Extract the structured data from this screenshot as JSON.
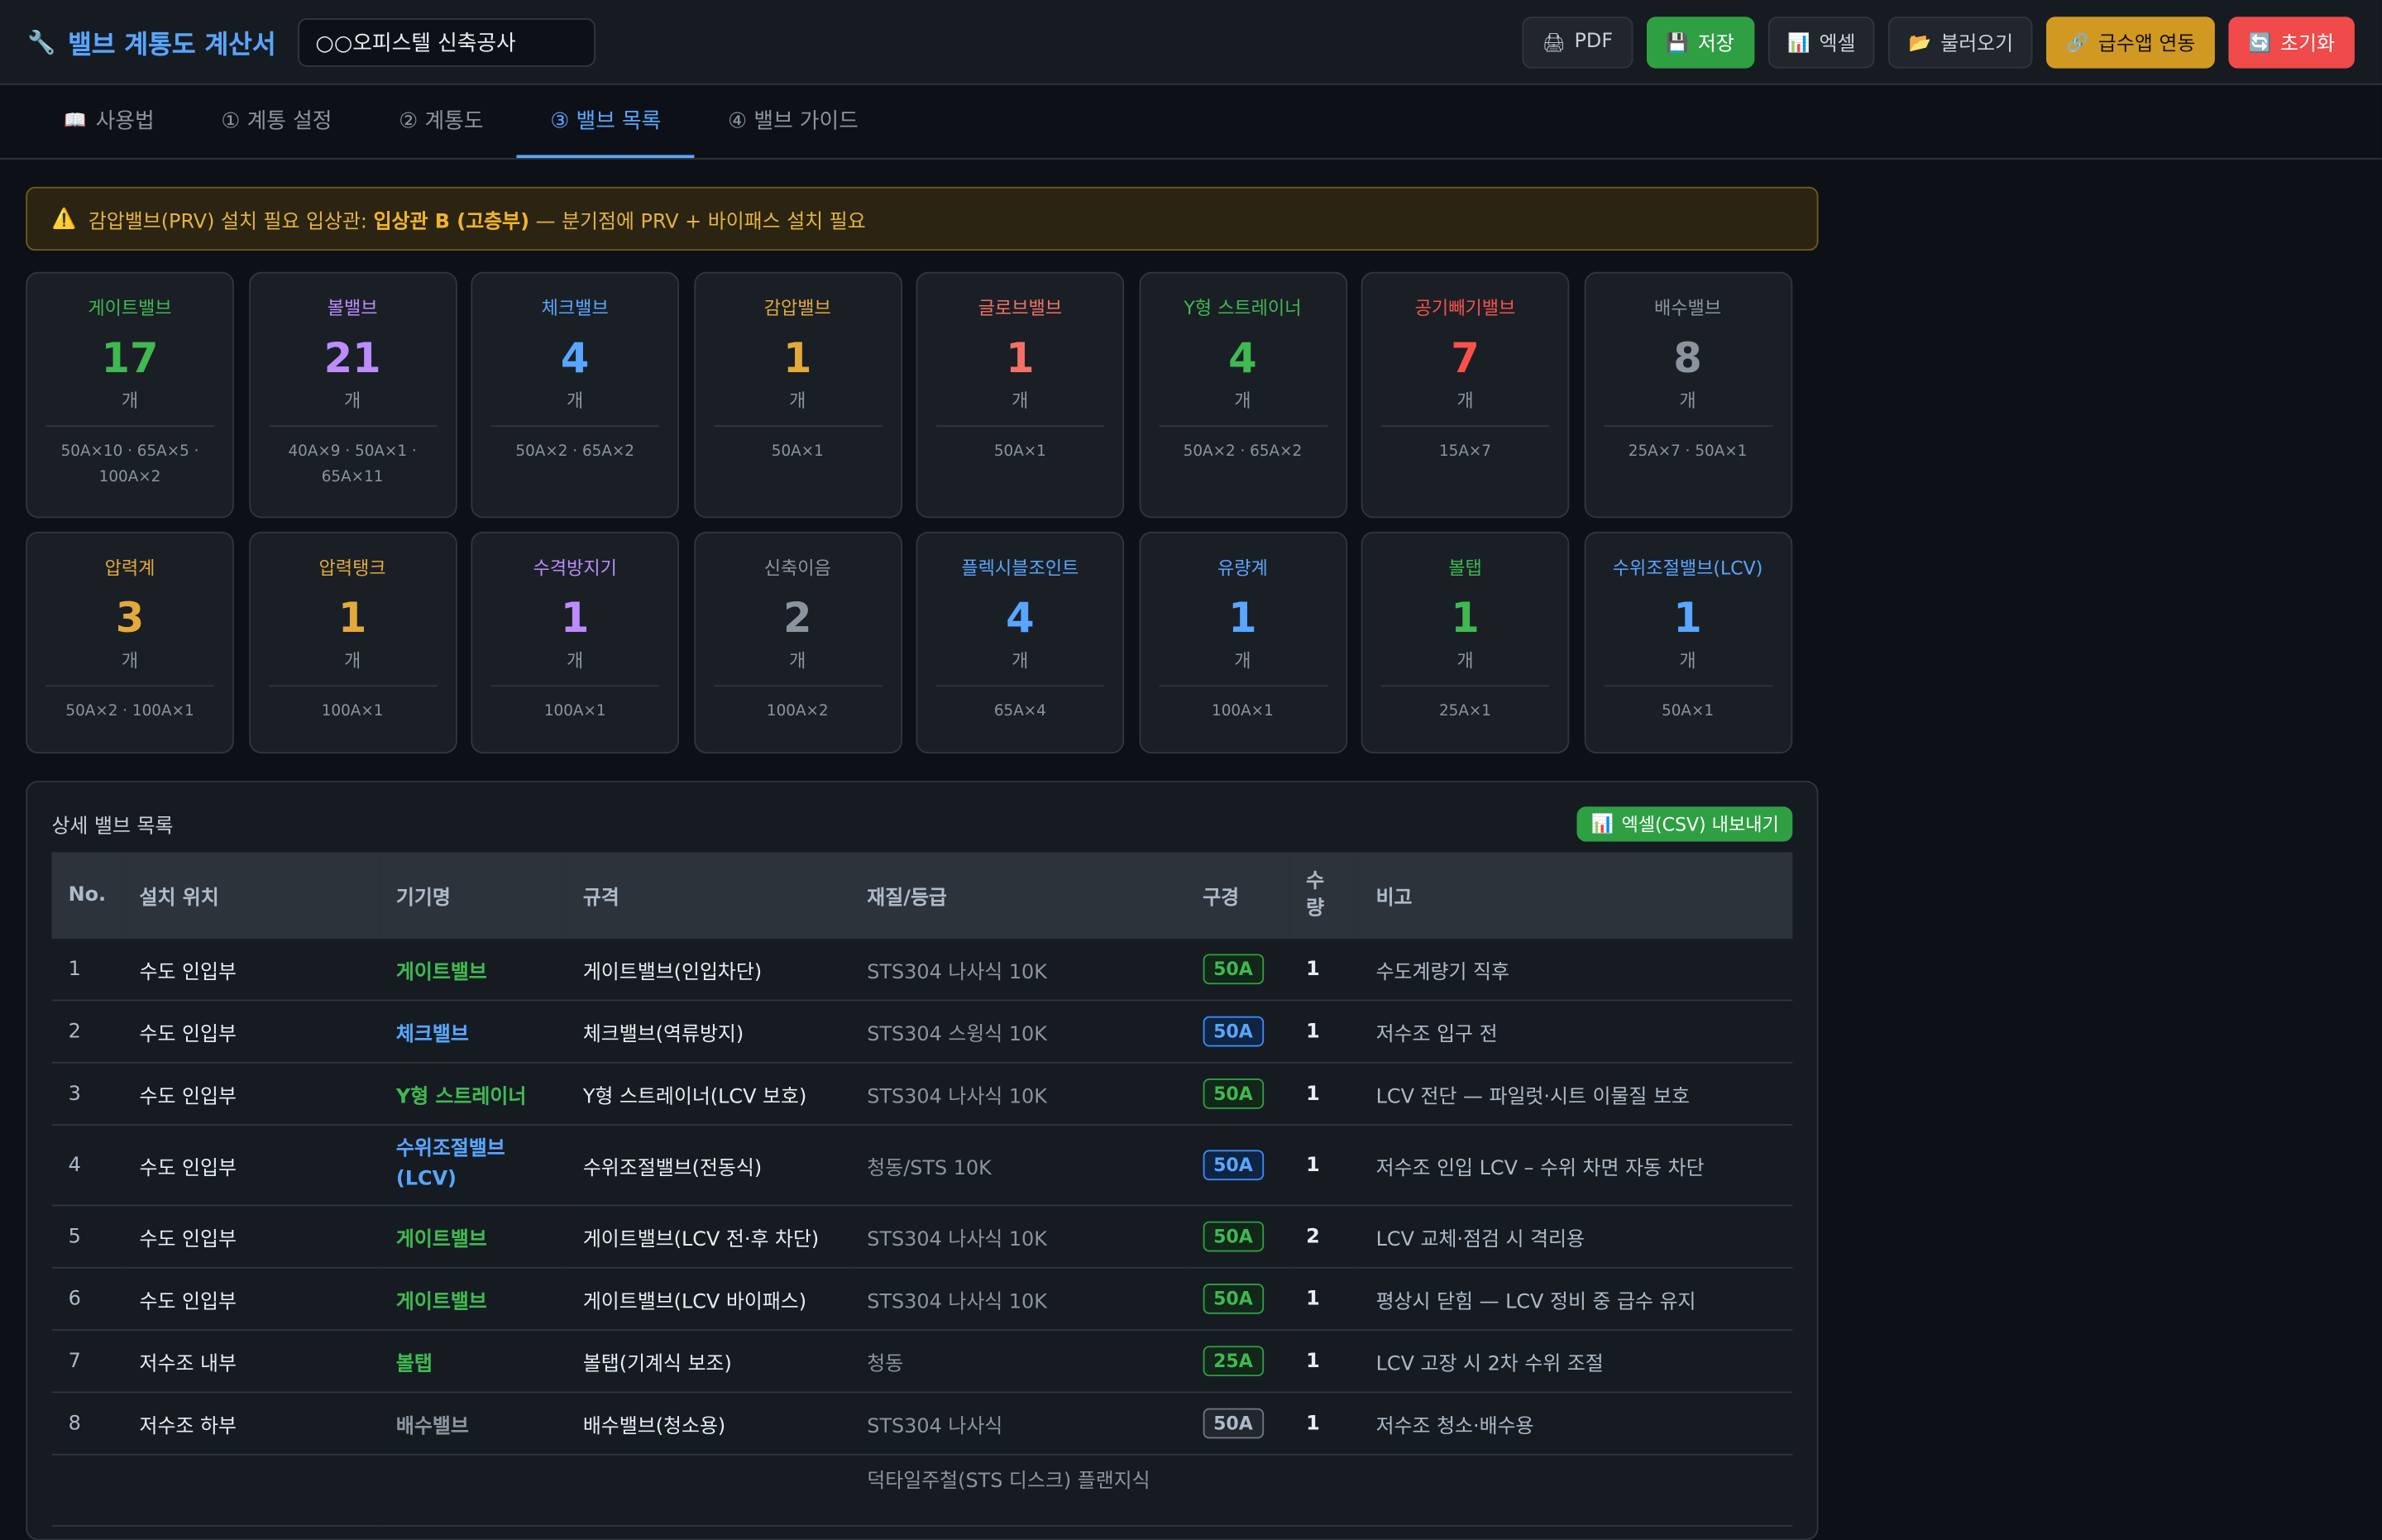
{
  "header": {
    "app_title": "밸브 계통도 계산서",
    "project_name": "○○오피스텔 신축공사",
    "buttons": {
      "pdf": "PDF",
      "save": "저장",
      "excel": "엑셀",
      "load": "불러오기",
      "link": "급수앱 연동",
      "reset": "초기화"
    }
  },
  "tabs": [
    {
      "label": "사용법"
    },
    {
      "label": "① 계통 설정"
    },
    {
      "label": "② 계통도"
    },
    {
      "label": "③ 밸브 목록"
    },
    {
      "label": "④ 밸브 가이드"
    }
  ],
  "alert": {
    "text_before": "감압밸브(PRV) 설치 필요 입상관: ",
    "highlight": "입상관 B (고층부)",
    "text_after": " — 분기점에 PRV + 바이패스 설치 필요"
  },
  "summary_cards": [
    {
      "name": "게이트밸브",
      "count": "17",
      "unit": "개",
      "detail": "50A×10 · 65A×5 · 100A×2",
      "color": "#3fb950"
    },
    {
      "name": "볼밸브",
      "count": "21",
      "unit": "개",
      "detail": "40A×9 · 50A×1 · 65A×11",
      "color": "#bc8cff"
    },
    {
      "name": "체크밸브",
      "count": "4",
      "unit": "개",
      "detail": "50A×2 · 65A×2",
      "color": "#58a6ff"
    },
    {
      "name": "감압밸브",
      "count": "1",
      "unit": "개",
      "detail": "50A×1",
      "color": "#e3a93b"
    },
    {
      "name": "글로브밸브",
      "count": "1",
      "unit": "개",
      "detail": "50A×1",
      "color": "#f47067"
    },
    {
      "name": "Y형 스트레이너",
      "count": "4",
      "unit": "개",
      "detail": "50A×2 · 65A×2",
      "color": "#3fb950"
    },
    {
      "name": "공기빼기밸브",
      "count": "7",
      "unit": "개",
      "detail": "15A×7",
      "color": "#f85149"
    },
    {
      "name": "배수밸브",
      "count": "8",
      "unit": "개",
      "detail": "25A×7 · 50A×1",
      "color": "#8b949e"
    },
    {
      "name": "압력계",
      "count": "3",
      "unit": "개",
      "detail": "50A×2 · 100A×1",
      "color": "#e3a93b"
    },
    {
      "name": "압력탱크",
      "count": "1",
      "unit": "개",
      "detail": "100A×1",
      "color": "#e3a93b"
    },
    {
      "name": "수격방지기",
      "count": "1",
      "unit": "개",
      "detail": "100A×1",
      "color": "#bc8cff"
    },
    {
      "name": "신축이음",
      "count": "2",
      "unit": "개",
      "detail": "100A×2",
      "color": "#8b949e"
    },
    {
      "name": "플렉시블조인트",
      "count": "4",
      "unit": "개",
      "detail": "65A×4",
      "color": "#58a6ff"
    },
    {
      "name": "유량계",
      "count": "1",
      "unit": "개",
      "detail": "100A×1",
      "color": "#58a6ff"
    },
    {
      "name": "볼탭",
      "count": "1",
      "unit": "개",
      "detail": "25A×1",
      "color": "#3fb950"
    },
    {
      "name": "수위조절밸브(LCV)",
      "count": "1",
      "unit": "개",
      "detail": "50A×1",
      "color": "#58a6ff"
    }
  ],
  "detail_panel": {
    "title": "상세 밸브 목록",
    "csv_button": "엑셀(CSV) 내보내기",
    "columns": [
      "No.",
      "설치 위치",
      "기기명",
      "규격",
      "재질/등급",
      "구경",
      "수\n량",
      "비고"
    ],
    "rows": [
      {
        "no": "1",
        "location": "수도 인입부",
        "device": "게이트밸브",
        "spec": "게이트밸브(인입차단)",
        "material": "STS304 나사식 10K",
        "size": "50A",
        "qty": "1",
        "note": "수도계량기 직후",
        "color": "#3fb950"
      },
      {
        "no": "2",
        "location": "수도 인입부",
        "device": "체크밸브",
        "spec": "체크밸브(역류방지)",
        "material": "STS304 스윙식 10K",
        "size": "50A",
        "qty": "1",
        "note": "저수조 입구 전",
        "color": "#58a6ff"
      },
      {
        "no": "3",
        "location": "수도 인입부",
        "device": "Y형 스트레이너",
        "spec": "Y형 스트레이너(LCV 보호)",
        "material": "STS304 나사식 10K",
        "size": "50A",
        "qty": "1",
        "note": "LCV 전단 — 파일럿·시트 이물질 보호",
        "color": "#3fb950"
      },
      {
        "no": "4",
        "location": "수도 인입부",
        "device": "수위조절밸브(LCV)",
        "spec": "수위조절밸브(전동식)",
        "material": "청동/STS 10K",
        "size": "50A",
        "qty": "1",
        "note": "저수조 인입 LCV – 수위 차면 자동 차단",
        "color": "#58a6ff"
      },
      {
        "no": "5",
        "location": "수도 인입부",
        "device": "게이트밸브",
        "spec": "게이트밸브(LCV 전·후 차단)",
        "material": "STS304 나사식 10K",
        "size": "50A",
        "qty": "2",
        "note": "LCV 교체·점검 시 격리용",
        "color": "#3fb950"
      },
      {
        "no": "6",
        "location": "수도 인입부",
        "device": "게이트밸브",
        "spec": "게이트밸브(LCV 바이패스)",
        "material": "STS304 나사식 10K",
        "size": "50A",
        "qty": "1",
        "note": "평상시 닫힘 — LCV 정비 중 급수 유지",
        "color": "#3fb950"
      },
      {
        "no": "7",
        "location": "저수조 내부",
        "device": "볼탭",
        "spec": "볼탭(기계식 보조)",
        "material": "청동",
        "size": "25A",
        "qty": "1",
        "note": "LCV 고장 시 2차 수위 조절",
        "color": "#3fb950"
      },
      {
        "no": "8",
        "location": "저수조 하부",
        "device": "배수밸브",
        "spec": "배수밸브(청소용)",
        "material": "STS304 나사식",
        "size": "50A",
        "qty": "1",
        "note": "저수조 청소·배수용",
        "color": "#8b949e"
      },
      {
        "no": "",
        "location": "",
        "device": "",
        "spec": "",
        "material": "덕타일주철(STS 디스크) 플랜지식",
        "size": "",
        "qty": "",
        "note": "",
        "color": "#3fb950"
      }
    ]
  },
  "icons": {
    "wrench": "wrench-icon",
    "pdf": "printer-icon",
    "save": "floppy-icon",
    "excel": "chart-icon",
    "load": "folder-icon",
    "link": "link-icon",
    "reset": "refresh-icon",
    "book": "book-icon",
    "warn": "warning-icon"
  }
}
